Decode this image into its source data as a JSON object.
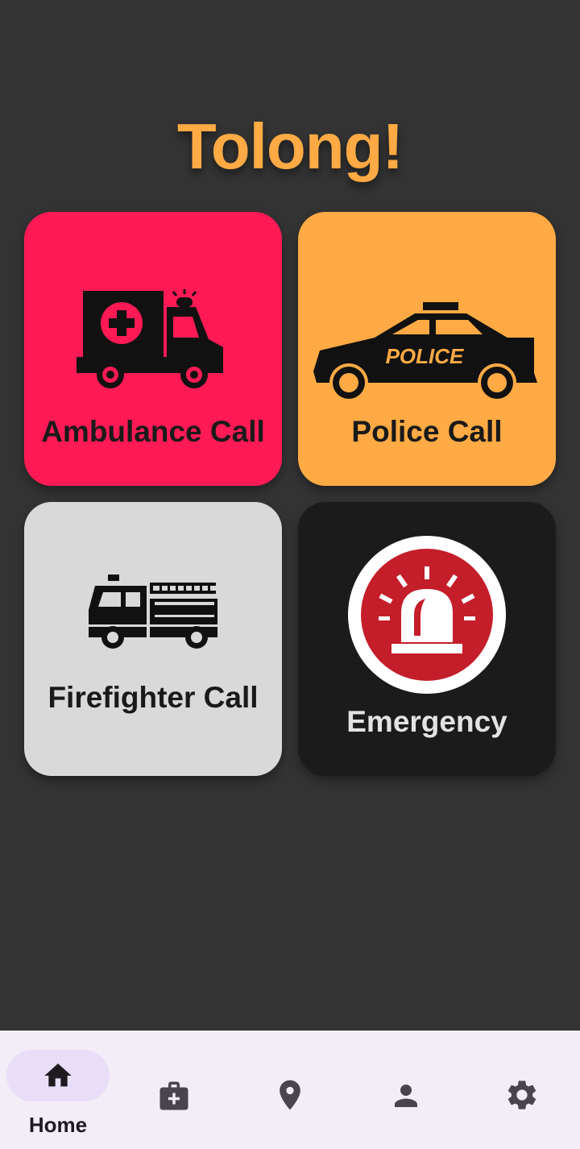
{
  "app": {
    "title": "Tolong!",
    "title_color": "#FFAA44",
    "background": "#333333"
  },
  "cards": {
    "ambulance": {
      "label": "Ambulance Call",
      "color": "#FF1A55",
      "icon": "ambulance-icon"
    },
    "police": {
      "label": "Police Call",
      "color": "#FFAA44",
      "icon": "police-car-icon",
      "badge_text": "POLICE"
    },
    "fire": {
      "label": "Firefighter Call",
      "color": "#D9D9D9",
      "icon": "fire-truck-icon"
    },
    "emergency": {
      "label": "Emergency",
      "color": "#1B1B1B",
      "icon": "siren-icon"
    }
  },
  "bottom_nav": {
    "items": [
      {
        "label": "Home",
        "icon": "home-icon",
        "selected": true
      },
      {
        "label": "",
        "icon": "medical-kit-icon",
        "selected": false
      },
      {
        "label": "",
        "icon": "location-pin-icon",
        "selected": false
      },
      {
        "label": "",
        "icon": "person-icon",
        "selected": false
      },
      {
        "label": "",
        "icon": "settings-icon",
        "selected": false
      }
    ]
  }
}
